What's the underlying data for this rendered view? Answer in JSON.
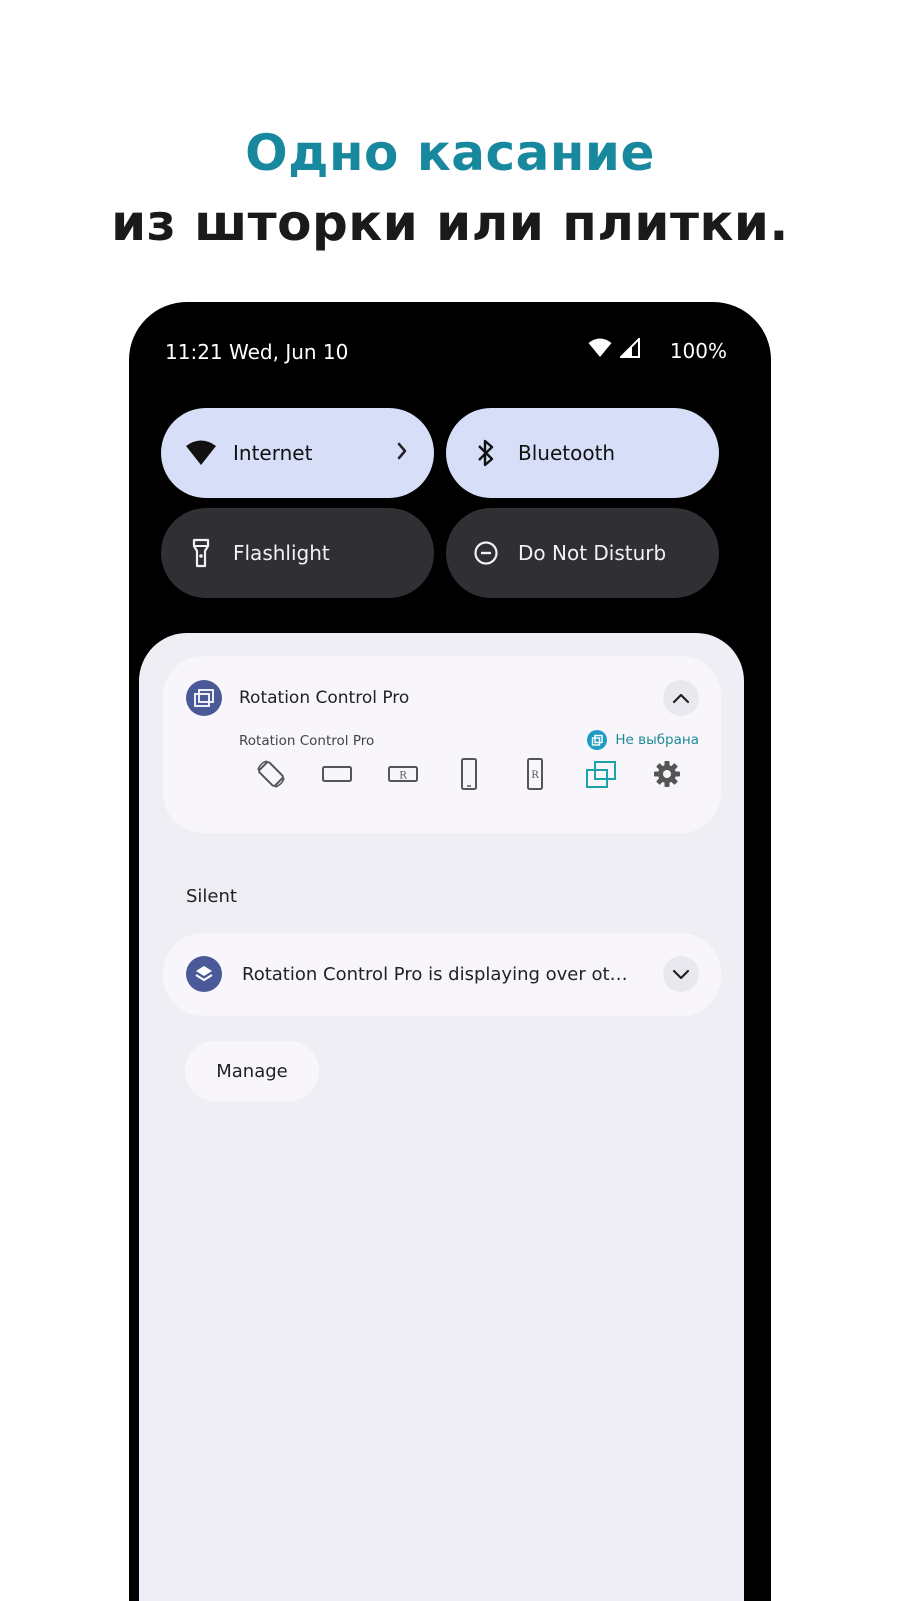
{
  "headline": {
    "line1": "Одно касание",
    "line2": "из шторки или плитки."
  },
  "statusbar": {
    "time": "11:21 Wed, Jun 10",
    "battery": "100%",
    "icons": [
      "wifi-icon",
      "cellular-signal-icon"
    ]
  },
  "tiles": [
    {
      "label": "Internet",
      "icon": "wifi-icon",
      "state": "on",
      "has_chevron": true
    },
    {
      "label": "Bluetooth",
      "icon": "bluetooth-icon",
      "state": "on"
    },
    {
      "label": "Flashlight",
      "icon": "flashlight-icon",
      "state": "off"
    },
    {
      "label": "Do Not Disturb",
      "icon": "do-not-disturb-icon",
      "state": "off"
    }
  ],
  "notification_main": {
    "app_name": "Rotation Control Pro",
    "subtitle": "Rotation Control Pro",
    "status": "Не выбрана",
    "actions": [
      "auto-rotate-icon",
      "landscape-icon",
      "reverse-landscape-icon",
      "portrait-icon",
      "reverse-portrait-icon",
      "not-selected-icon",
      "settings-icon"
    ],
    "accent_color": "#1d8a96"
  },
  "section_label": "Silent",
  "notification_silent": {
    "text": "Rotation Control Pro is displaying over ot…"
  },
  "manage_label": "Manage",
  "colors": {
    "headline_accent": "#17889e",
    "tile_on": "#d7def8",
    "tile_off": "#303034",
    "app_icon": "#4a5a98"
  }
}
